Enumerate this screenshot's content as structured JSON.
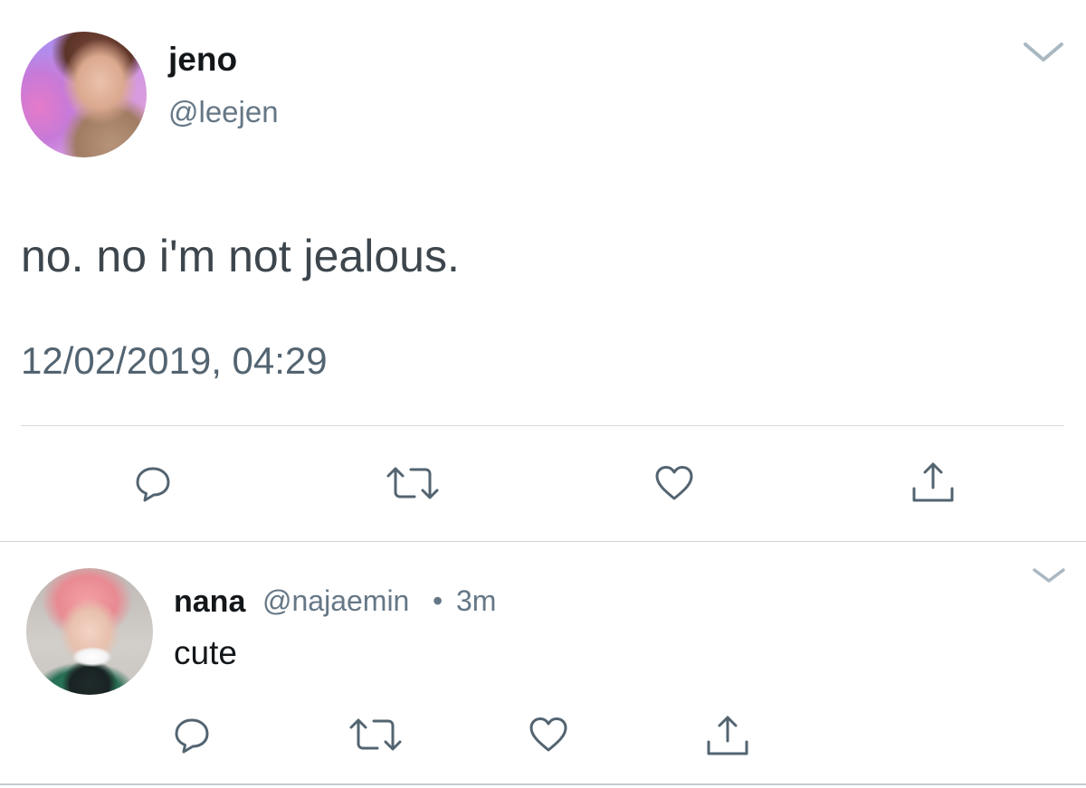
{
  "main_tweet": {
    "author_name": "jeno",
    "author_handle": "@leejen",
    "text": "no. no i'm not jealous.",
    "timestamp": "12/02/2019, 04:29",
    "avatar_icon": "profile-photo",
    "menu_icon": "chevron-down-icon",
    "actions": [
      "reply-icon",
      "retweet-icon",
      "like-icon",
      "share-icon"
    ]
  },
  "reply_tweet": {
    "author_name": "nana",
    "author_handle": "@najaemin",
    "separator": "•",
    "time_ago": "3m",
    "text": "cute",
    "avatar_icon": "profile-photo",
    "menu_icon": "chevron-down-icon",
    "actions": [
      "reply-icon",
      "retweet-icon",
      "like-icon",
      "share-icon"
    ]
  },
  "colors": {
    "primary_text": "#14171a",
    "secondary_text": "#657786",
    "tweet_body": "#3d464d",
    "icon_gray": "#536471",
    "divider": "#d6dbe0"
  }
}
